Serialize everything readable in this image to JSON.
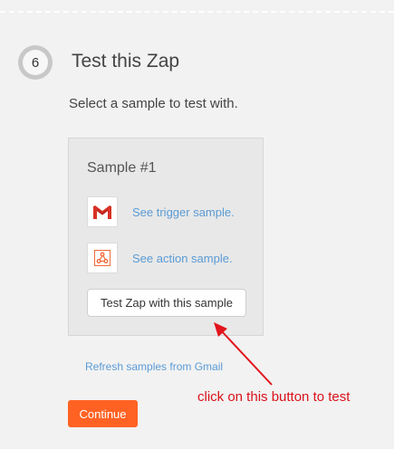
{
  "step": {
    "number": "6",
    "title": "Test this Zap",
    "subtitle": "Select a sample to test with."
  },
  "sample": {
    "title": "Sample #1",
    "trigger_link": "See trigger sample.",
    "action_link": "See action sample.",
    "test_button": "Test Zap with this sample"
  },
  "refresh_link": "Refresh samples from Gmail",
  "continue_button": "Continue",
  "annotation": {
    "text": "click on this button to test",
    "color": "#d9121a"
  },
  "icons": {
    "trigger_app": "gmail-icon",
    "action_app": "webhook-icon"
  },
  "colors": {
    "accent": "#ff6223",
    "link": "#5b9bd5"
  }
}
